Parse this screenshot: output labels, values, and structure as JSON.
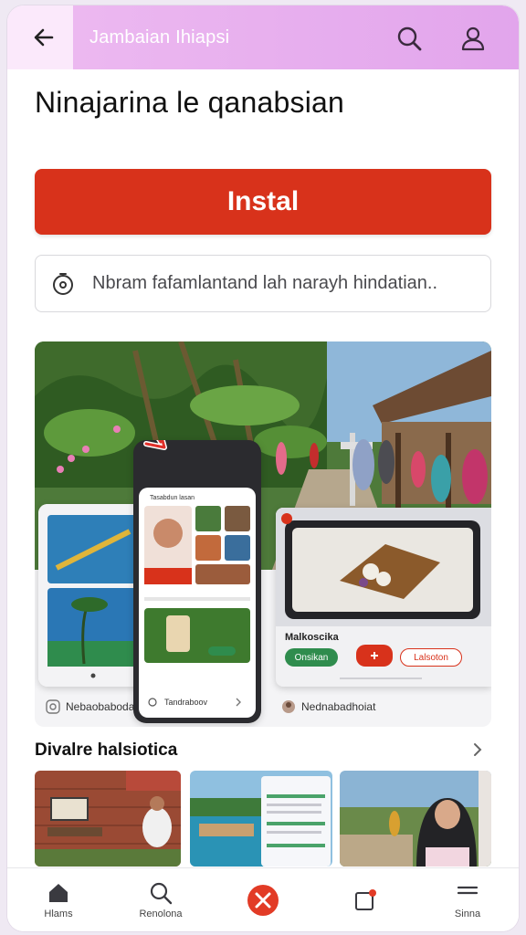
{
  "header": {
    "title": "Jambaian Ihiapsi",
    "back_icon": "arrow-left-icon",
    "search_icon": "search-icon",
    "profile_icon": "user-icon"
  },
  "headline": "Ninajarina le qanabsian",
  "install_button": {
    "label": "Instal",
    "color": "#d8321b"
  },
  "search": {
    "text": "Nbram fafamlantand lah narayh hindatian..",
    "icon": "timer-icon"
  },
  "showcase": {
    "left_card": {
      "label": "Nebaobabodan",
      "icon": "info-icon"
    },
    "phone_card": {
      "header": "Tasabdun lasan",
      "footer": "Tandraboov",
      "icon": "circle-icon",
      "chevron": "chevron-right-icon"
    },
    "right_card": {
      "title": "Malkoscika",
      "pills": [
        "Onsikan",
        "",
        "Lalsoton"
      ],
      "label": "Nednabadhoiat",
      "icon": "avatar-icon"
    }
  },
  "section": {
    "title": "Divalre halsiotica",
    "chevron": "chevron-right-icon"
  },
  "nav": {
    "items": [
      {
        "label": "Hlams",
        "icon": "home-icon"
      },
      {
        "label": "Renolona",
        "icon": "search-icon"
      },
      {
        "label": "",
        "icon": "close-icon"
      },
      {
        "label": "",
        "icon": "notification-icon"
      },
      {
        "label": "Sinna",
        "icon": "menu-icon"
      }
    ]
  },
  "colors": {
    "accent": "#d8321b",
    "header_bg": "#e6acee",
    "green": "#2f8c4d"
  }
}
